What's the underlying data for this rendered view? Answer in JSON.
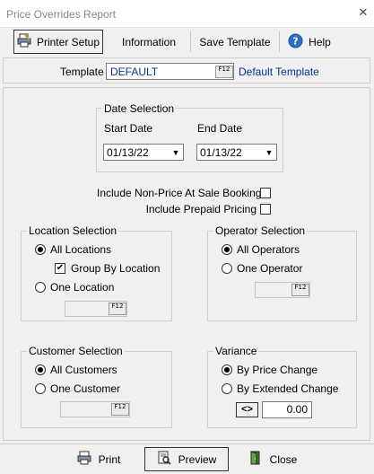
{
  "window": {
    "title": "Price Overrides Report",
    "close_glyph": "✕"
  },
  "toolbar": {
    "printer_setup": "Printer Setup",
    "information": "Information",
    "save_template": "Save Template",
    "help": "Help"
  },
  "template": {
    "label": "Template",
    "value": "DEFAULT",
    "description": "Default Template",
    "f12": "F12"
  },
  "date_selection": {
    "title": "Date Selection",
    "start_label": "Start Date",
    "end_label": "End Date",
    "start_value": "01/13/22",
    "end_value": "01/13/22"
  },
  "options": {
    "include_non_price": "Include Non-Price At Sale Bookings",
    "include_prepaid": "Include Prepaid Pricing"
  },
  "location": {
    "title": "Location Selection",
    "all": "All Locations",
    "group_by": "Group By Location",
    "one": "One Location",
    "f12": "F12"
  },
  "operator": {
    "title": "Operator Selection",
    "all": "All Operators",
    "one": "One Operator",
    "f12": "F12"
  },
  "customer": {
    "title": "Customer Selection",
    "all": "All Customers",
    "one": "One Customer",
    "f12": "F12"
  },
  "variance": {
    "title": "Variance",
    "by_price": "By Price Change",
    "by_extended": "By Extended Change",
    "toggle": "<>",
    "value": "0.00"
  },
  "footer": {
    "print": "Print",
    "preview": "Preview",
    "close": "Close"
  },
  "icons": {
    "printer_setup": "printer-setup-icon",
    "help": "help-icon",
    "print": "print-icon",
    "preview": "preview-icon",
    "close": "close-door-icon"
  }
}
